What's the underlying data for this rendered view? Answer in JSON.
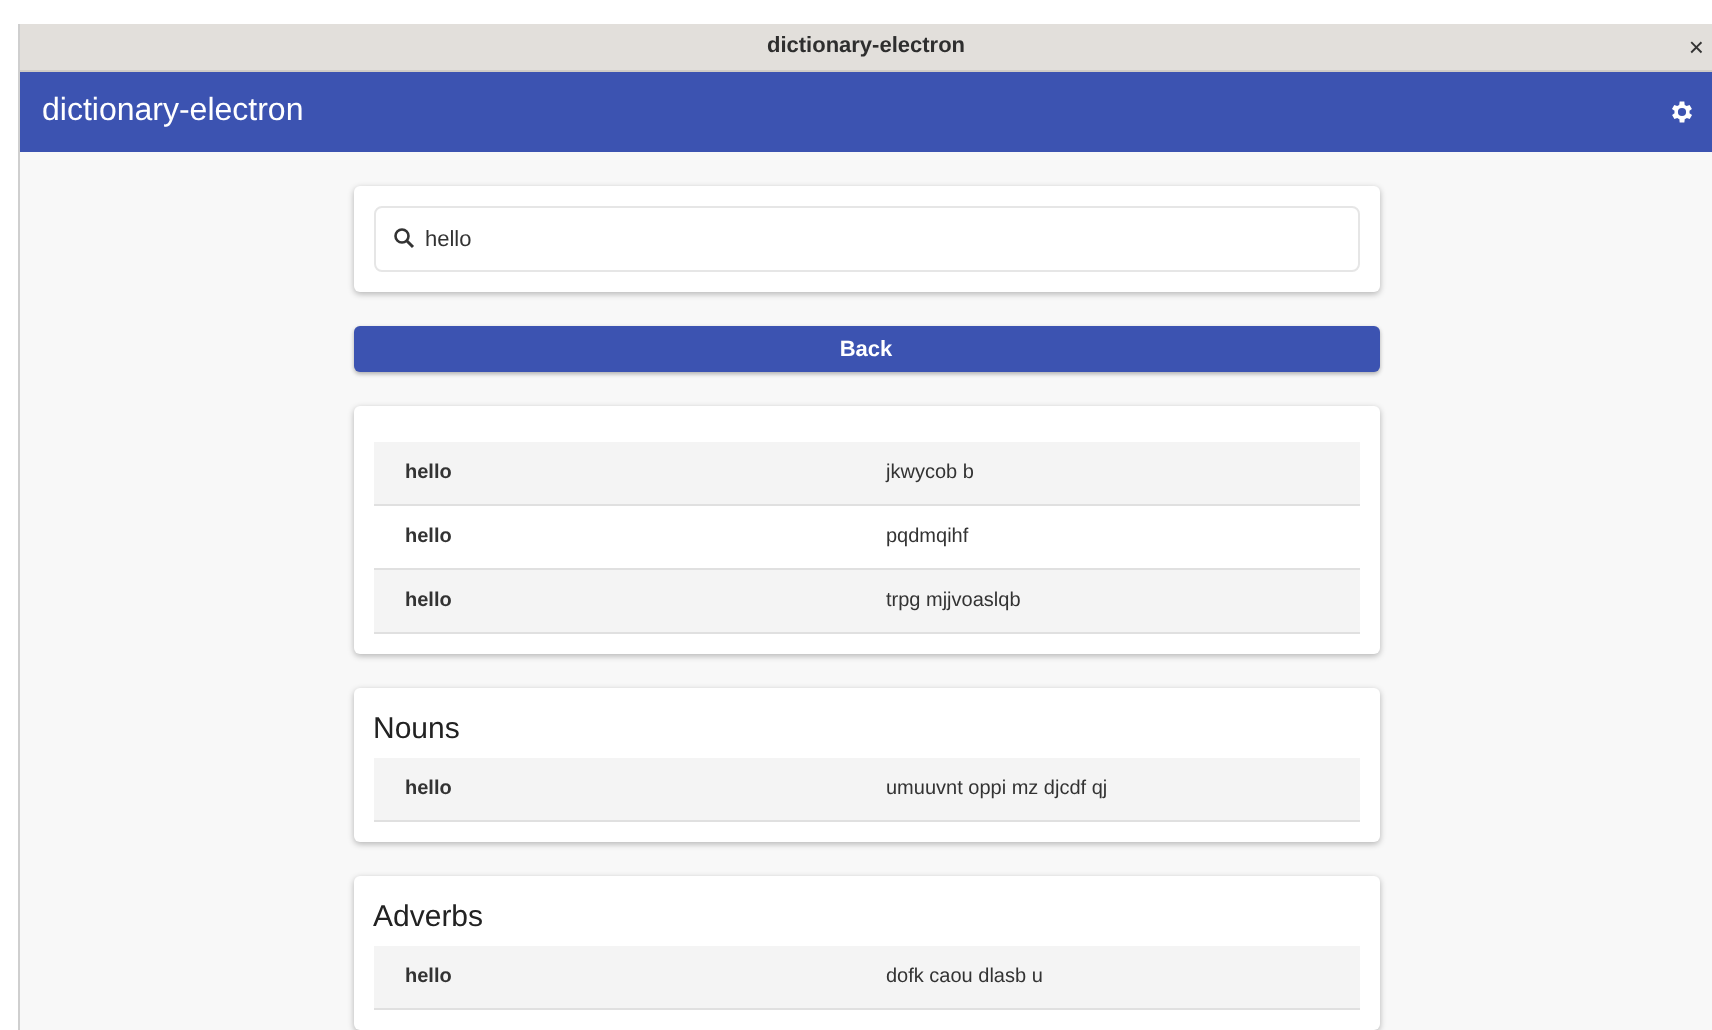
{
  "window": {
    "title": "dictionary-electron",
    "close": "×"
  },
  "app_bar": {
    "title": "dictionary-electron"
  },
  "search": {
    "value": "hello"
  },
  "back_button": "Back",
  "sections": [
    {
      "rows": [
        {
          "word": "hello",
          "definition": "jkwycob b"
        },
        {
          "word": "hello",
          "definition": "pqdmqihf"
        },
        {
          "word": "hello",
          "definition": "trpg mjjvoaslqb"
        }
      ]
    },
    {
      "heading": "Nouns",
      "rows": [
        {
          "word": "hello",
          "definition": "umuuvnt oppi mz djcdf qj"
        }
      ]
    },
    {
      "heading": "Adverbs",
      "rows": [
        {
          "word": "hello",
          "definition": "dofk caou dlasb u"
        }
      ]
    }
  ]
}
